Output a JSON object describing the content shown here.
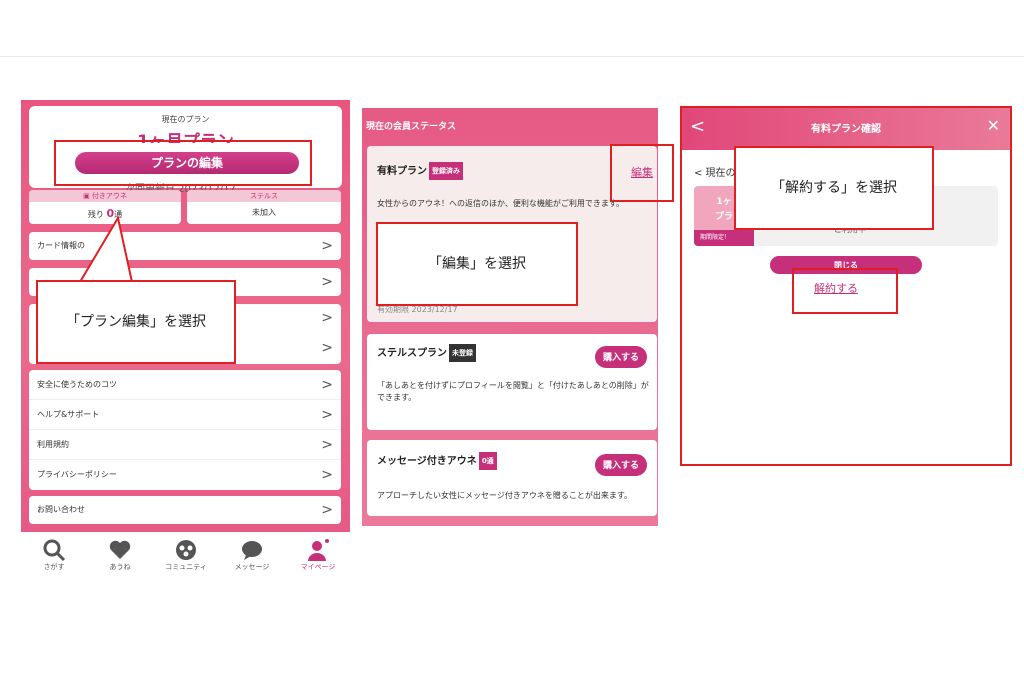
{
  "panel1": {
    "current_plan_label": "現在のプラン",
    "plan_name": "1ヶ月プラン",
    "edit_button": "プランの編集",
    "renewal_text": "次回更新日 2023/12/17",
    "awoon_header": "付きアウネ",
    "awoon_value_prefix": "残り",
    "awoon_value": "0",
    "awoon_value_suffix": "通",
    "stealth_header": "ステルス",
    "stealth_value": "未加入",
    "menu_card_info": "カード情報の",
    "list_items": [
      "安全に使うためのコツ",
      "ヘルプ&サポート",
      "利用規約",
      "プライバシーポリシー"
    ],
    "contact": "お問い合わせ",
    "chevron": ">",
    "annotation": "「プラン編集」を選択"
  },
  "tabbar": {
    "tabs": [
      "さがす",
      "あうね",
      "コミュニティ",
      "メッセージ",
      "マイページ"
    ]
  },
  "panel2": {
    "header": "現在の会員ステータス",
    "paid_title": "有料プラン",
    "paid_tag": "登録済み",
    "paid_desc": "女性からのアウネ！への返信のほか、便利な機能がご利用できます。",
    "edit_link": "編集",
    "expiry": "有効期限 2023/12/17",
    "stealth_title": "ステルスプラン",
    "stealth_tag": "未登録",
    "stealth_desc": "「あしあとを付けずにプロフィールを閲覧」と「付けたあしあとの削除」ができます。",
    "msg_title": "メッセージ付きアウネ",
    "msg_tag": "0通",
    "msg_desc": "アプローチしたい女性にメッセージ付きアウネを贈ることが出来ます。",
    "buy_label": "購入する",
    "annotation": "「編集」を選択"
  },
  "panel3": {
    "back": "<",
    "title": "有料プラン確認",
    "close": "✕",
    "current_label": "< 現在の",
    "plan_line1": "1ヶ",
    "plan_line2": "プラ",
    "limited": "期間限定！",
    "price_tail": "ご利用中",
    "close_button": "閉じる",
    "cancel_link": "解約する",
    "annotation": "「解約する」を選択"
  },
  "colors": {
    "accent": "#c6307a",
    "annotation_red": "#e02020",
    "pink_bg": "#e9557f"
  }
}
